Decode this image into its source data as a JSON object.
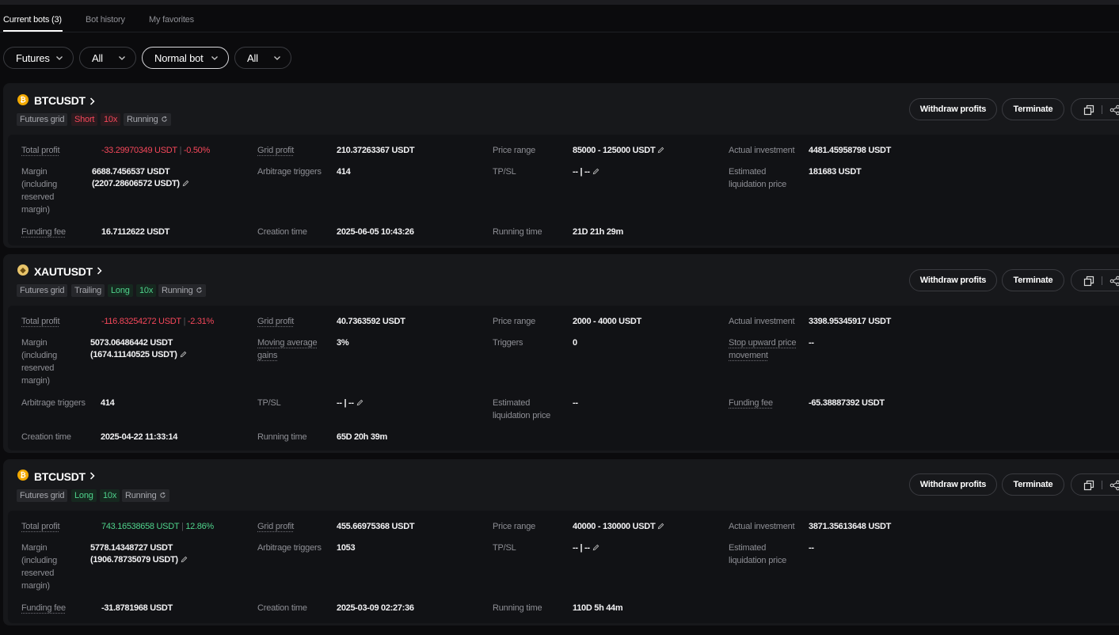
{
  "tabs": [
    "Current bots (3)",
    "Bot history",
    "My favorites"
  ],
  "filters": [
    "Futures",
    "All",
    "Normal bot",
    "All"
  ],
  "buttons": {
    "withdraw": "Withdraw profits",
    "terminate": "Terminate"
  },
  "colors": {
    "red": "#f5475a",
    "green": "#4fd38c",
    "background": "#0b0b0d"
  },
  "bots": [
    {
      "symbol": "BTCUSDT",
      "coin_icon": "bitcoin-icon",
      "tags": [
        "Futures grid",
        "Short",
        "10x",
        "Running"
      ],
      "fields": {
        "total_profit_label": "Total profit",
        "total_profit": "-33.29970349 USDT",
        "total_profit_pct": "-0.50%",
        "margin_label": "Margin (including reserved margin)",
        "margin": "6688.7456537 USDT",
        "margin_reserved": "(2207.28606572 USDT)",
        "funding_fee_label": "Funding fee",
        "funding_fee": "16.7112622 USDT",
        "grid_profit_label": "Grid profit",
        "grid_profit": "210.37263367 USDT",
        "arbitrage_label": "Arbitrage triggers",
        "arbitrage": "414",
        "creation_label": "Creation time",
        "creation": "2025-06-05 10:43:26",
        "price_range_label": "Price range",
        "price_range": "85000 - 125000 USDT",
        "tpsl_label": "TP/SL",
        "tpsl": "-- | --",
        "running_label": "Running time",
        "running": "21D 21h 29m",
        "actual_label": "Actual investment",
        "actual": "4481.45958798 USDT",
        "liq_label": "Estimated liquidation price",
        "liq": "181683 USDT"
      }
    },
    {
      "symbol": "XAUTUSDT",
      "coin_icon": "gold-coin-icon",
      "tags": [
        "Futures grid",
        "Trailing",
        "Long",
        "10x",
        "Running"
      ],
      "fields": {
        "total_profit_label": "Total profit",
        "total_profit": "-116.83254272 USDT",
        "total_profit_pct": "-2.31%",
        "margin_label": "Margin (including reserved margin)",
        "margin": "5073.06486442 USDT",
        "margin_reserved": "(1674.11140525 USDT)",
        "arbitrage_label": "Arbitrage triggers",
        "arbitrage": "414",
        "creation_label": "Creation time",
        "creation": "2025-04-22 11:33:14",
        "grid_profit_label": "Grid profit",
        "grid_profit": "40.7363592 USDT",
        "mag_label": "Moving average gains",
        "mag": "3%",
        "tpsl_label": "TP/SL",
        "tpsl": "-- | --",
        "running_label": "Running time",
        "running": "65D 20h 39m",
        "price_range_label": "Price range",
        "price_range": "2000 - 4000 USDT",
        "triggers_label": "Triggers",
        "triggers": "0",
        "liq_label": "Estimated liquidation price",
        "liq": "--",
        "actual_label": "Actual investment",
        "actual": "3398.95345917 USDT",
        "stop_label": "Stop upward price movement",
        "stop": "--",
        "funding_fee_label": "Funding fee",
        "funding_fee": "-65.38887392 USDT"
      }
    },
    {
      "symbol": "BTCUSDT",
      "coin_icon": "bitcoin-icon",
      "tags": [
        "Futures grid",
        "Long",
        "10x",
        "Running"
      ],
      "fields": {
        "total_profit_label": "Total profit",
        "total_profit": "743.16538658 USDT",
        "total_profit_pct": "12.86%",
        "margin_label": "Margin (including reserved margin)",
        "margin": "5778.14348727 USDT",
        "margin_reserved": "(1906.78735079 USDT)",
        "funding_fee_label": "Funding fee",
        "funding_fee": "-31.8781968 USDT",
        "grid_profit_label": "Grid profit",
        "grid_profit": "455.66975368 USDT",
        "arbitrage_label": "Arbitrage triggers",
        "arbitrage": "1053",
        "creation_label": "Creation time",
        "creation": "2025-03-09 02:27:36",
        "price_range_label": "Price range",
        "price_range": "40000 - 130000 USDT",
        "tpsl_label": "TP/SL",
        "tpsl": "-- | --",
        "running_label": "Running time",
        "running": "110D 5h 44m",
        "actual_label": "Actual investment",
        "actual": "3871.35613648 USDT",
        "liq_label": "Estimated liquidation price",
        "liq": "--"
      }
    }
  ]
}
